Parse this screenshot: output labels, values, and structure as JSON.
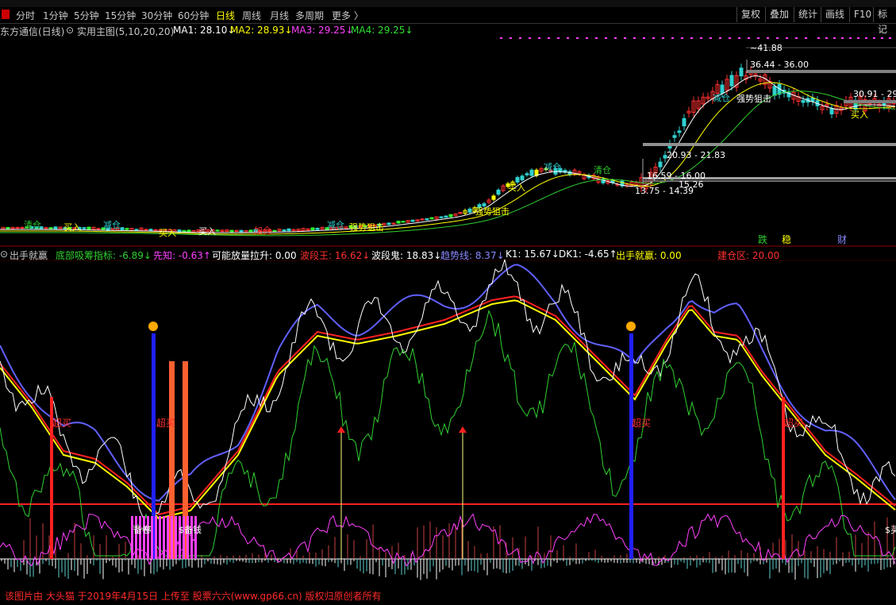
{
  "toolbar": {
    "periods": [
      "分时",
      "1分钟",
      "5分钟",
      "15分钟",
      "30分钟",
      "60分钟",
      "日线",
      "周线",
      "月线",
      "多周期",
      "更多 〉"
    ],
    "active_period": "日线",
    "right_buttons": [
      "复权",
      "叠加",
      "统计",
      "画线",
      "F10",
      "标记"
    ]
  },
  "main_info": {
    "stock": "东方通信(日线)",
    "indicator": "实用主图(5,10,20,20)",
    "ma1": "MA1: 28.10↓",
    "ma2": "MA2: 28.93↓",
    "ma3": "MA3: 29.25↓",
    "ma4": "MA4: 29.25↓"
  },
  "sub_info": {
    "name": "出手就赢",
    "items": [
      {
        "text": "底部吸筹指标: -6.89↓",
        "color": "#30d030"
      },
      {
        "text": "先知: -0.63↑",
        "color": "#ff40ff"
      },
      {
        "text": "可能放量拉升: 0.00",
        "color": "#ffffff"
      },
      {
        "text": "波段王: 16.62↓",
        "color": "#ff3030"
      },
      {
        "text": "波段鬼: 18.83↓",
        "color": "#ffffff"
      },
      {
        "text": "趋势线: 8.37↓",
        "color": "#8888ff"
      },
      {
        "text": "K1: 15.67↓",
        "color": "#ffffff"
      },
      {
        "text": "DK1: -4.65↑",
        "color": "#ffffff"
      },
      {
        "text": "出手就赢: 0.00",
        "color": "#ffff00"
      },
      {
        "text": "建仓区: 20.00",
        "color": "#ff3030"
      }
    ]
  },
  "price_labels": {
    "high": "41.88",
    "r1": "36.44 - 36.00",
    "r2": "30.91 - 29",
    "r3": "20.93 - 21.83",
    "r4": "16.59 - 16.00",
    "r5": "13.75 - 14.39",
    "r6": "15.26"
  },
  "signals": {
    "clear": "清仓",
    "buy": "买入",
    "reduce": "减仓",
    "add": "加仓",
    "strong": "强势狙击",
    "strong2": "强势狙击",
    "buy_in": "买入",
    "fall": "跌",
    "stable": "稳",
    "wealth": "财",
    "chaomai": "超买",
    "beijuan": "备卷",
    "money": "$备钱",
    "buy_star": "$买入"
  },
  "footer": "该图片由 大头猫 于2019年4月15日 上传至 股票六六(www.gp66.cn) 版权归原创者所有"
}
